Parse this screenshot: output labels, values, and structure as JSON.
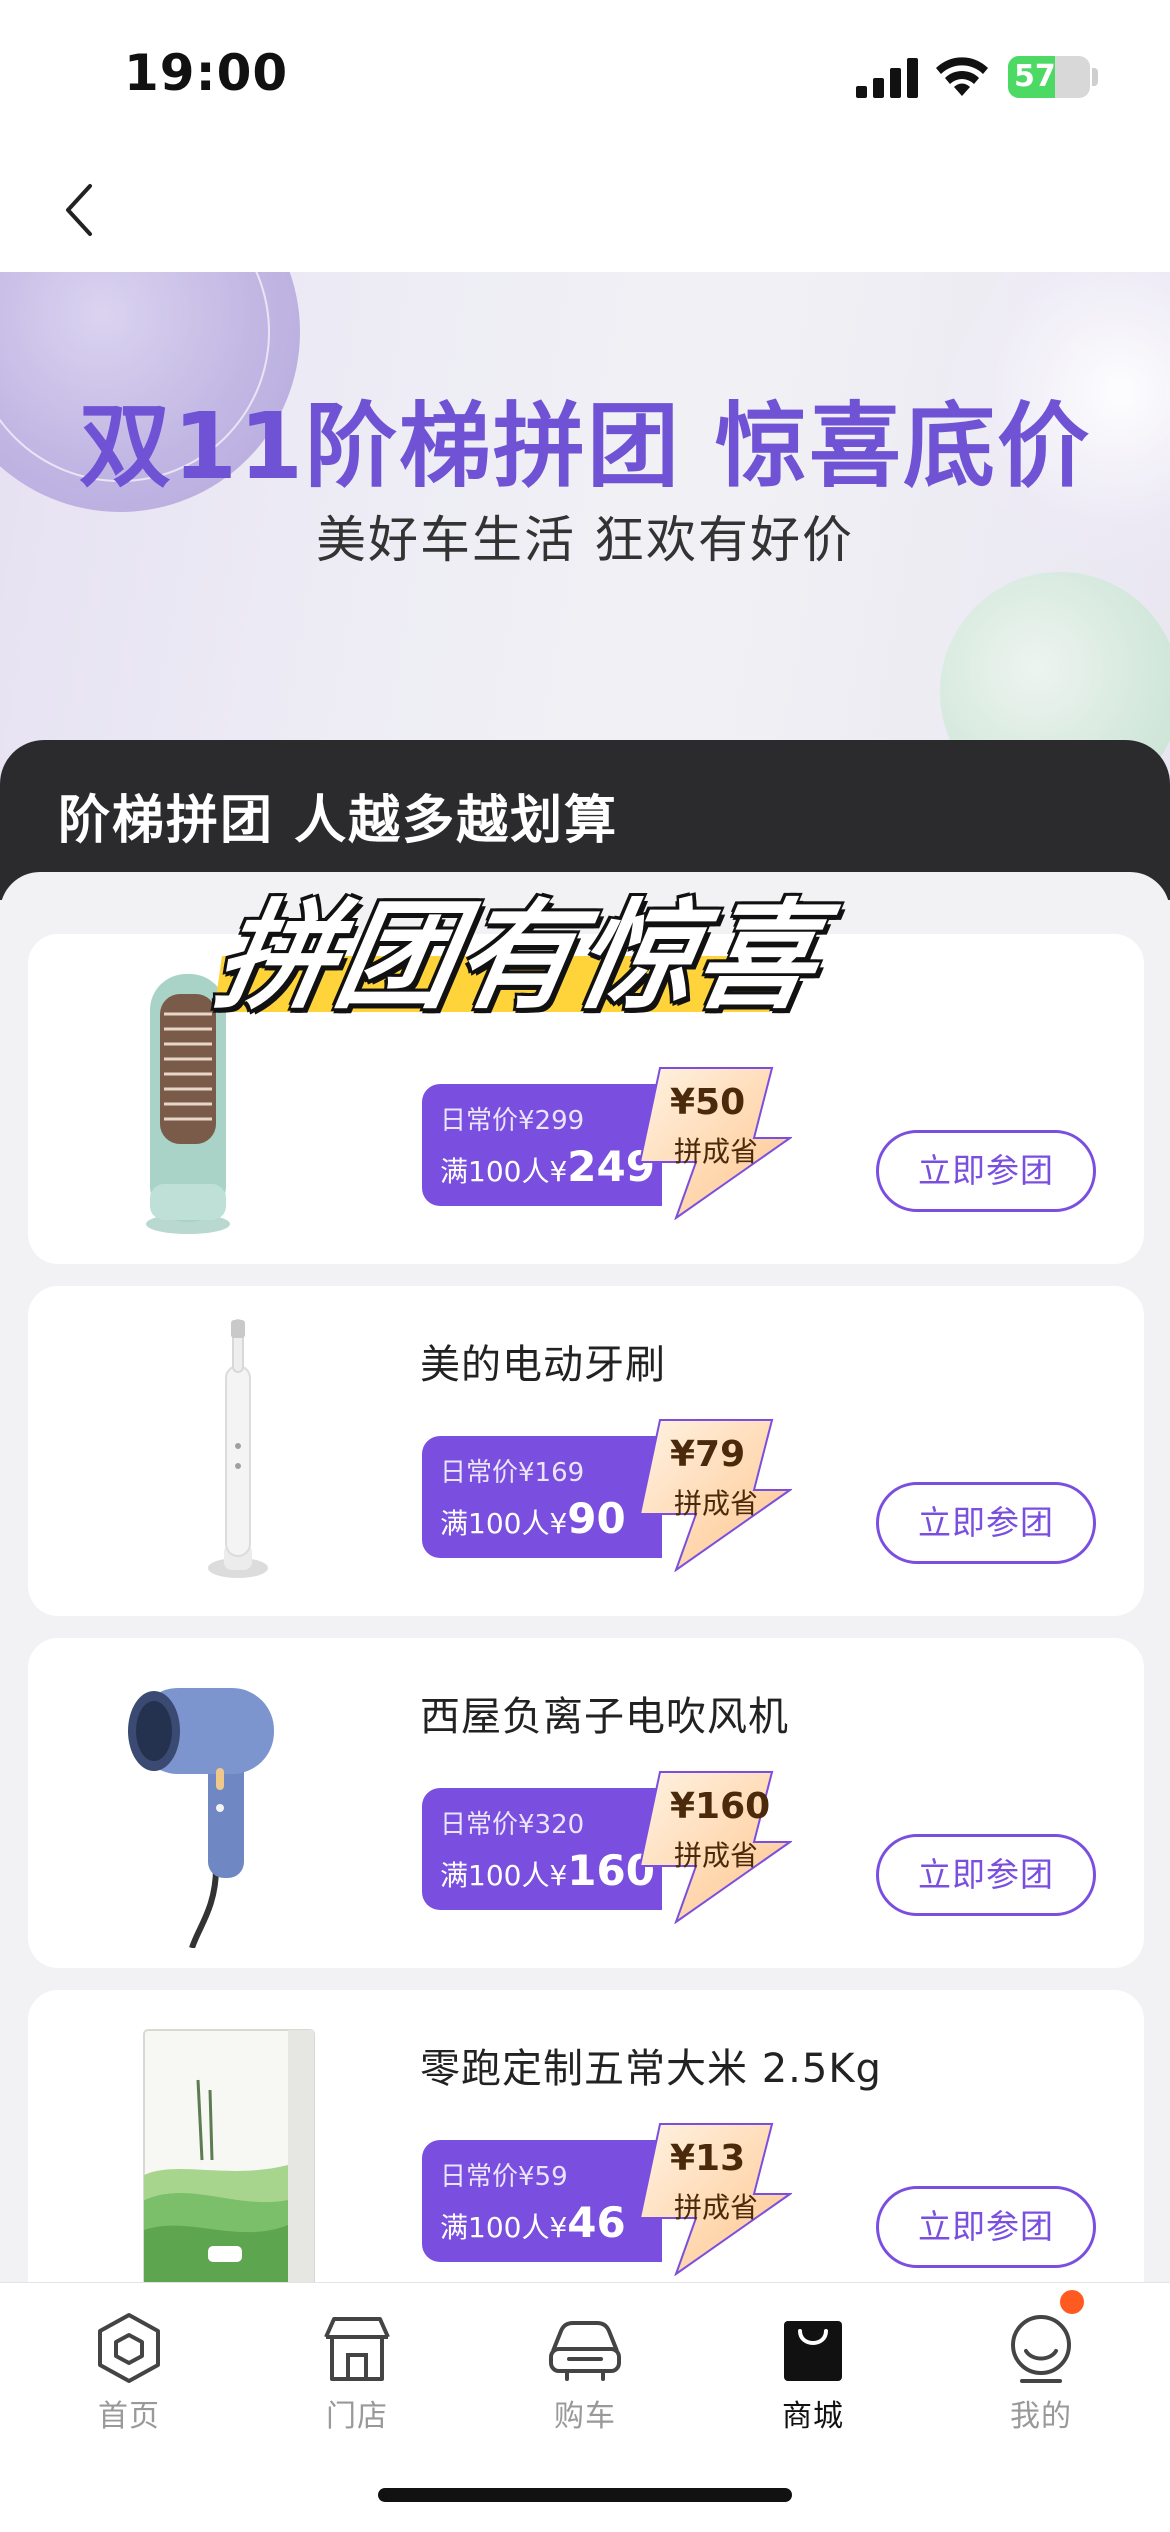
{
  "status_bar": {
    "time": "19:00",
    "battery_level": 0.57,
    "battery_text": "57"
  },
  "banner": {
    "title": "双11阶梯拼团 惊喜底价",
    "subtitle": "美好车生活 狂欢有好价"
  },
  "section": {
    "title": "阶梯拼团 人越多越划算",
    "sticker_text": "拼团有惊喜"
  },
  "products": [
    {
      "name": "",
      "icon": "space-heater",
      "orig_label": "日常价",
      "orig_price": "¥299",
      "group_label": "满100人",
      "group_currency": "¥",
      "group_price": "249",
      "save_amount": "¥50",
      "save_label": "拼成省",
      "button": "立即参团"
    },
    {
      "name": "美的电动牙刷",
      "icon": "electric-toothbrush",
      "orig_label": "日常价",
      "orig_price": "¥169",
      "group_label": "满100人",
      "group_currency": "¥",
      "group_price": "90",
      "save_amount": "¥79",
      "save_label": "拼成省",
      "button": "立即参团"
    },
    {
      "name": "西屋负离子电吹风机",
      "icon": "hair-dryer",
      "orig_label": "日常价",
      "orig_price": "¥320",
      "group_label": "满100人",
      "group_currency": "¥",
      "group_price": "160",
      "save_amount": "¥160",
      "save_label": "拼成省",
      "button": "立即参团"
    },
    {
      "name": "零跑定制五常大米 2.5Kg",
      "icon": "rice-box",
      "orig_label": "日常价",
      "orig_price": "¥59",
      "group_label": "满100人",
      "group_currency": "¥",
      "group_price": "46",
      "save_amount": "¥13",
      "save_label": "拼成省",
      "button": "立即参团"
    }
  ],
  "tabs": [
    {
      "label": "首页",
      "icon": "hexagon-home-icon"
    },
    {
      "label": "门店",
      "icon": "store-icon"
    },
    {
      "label": "购车",
      "icon": "car-icon"
    },
    {
      "label": "商城",
      "icon": "shopping-bag-icon",
      "active": true
    },
    {
      "label": "我的",
      "icon": "profile-icon"
    }
  ],
  "colors": {
    "accent": "#7a4fe0",
    "banner_title": "#7053d4",
    "header_dark": "#2b2b2e",
    "badge": "#ffd9b0",
    "sticker": "#ffd43b"
  }
}
